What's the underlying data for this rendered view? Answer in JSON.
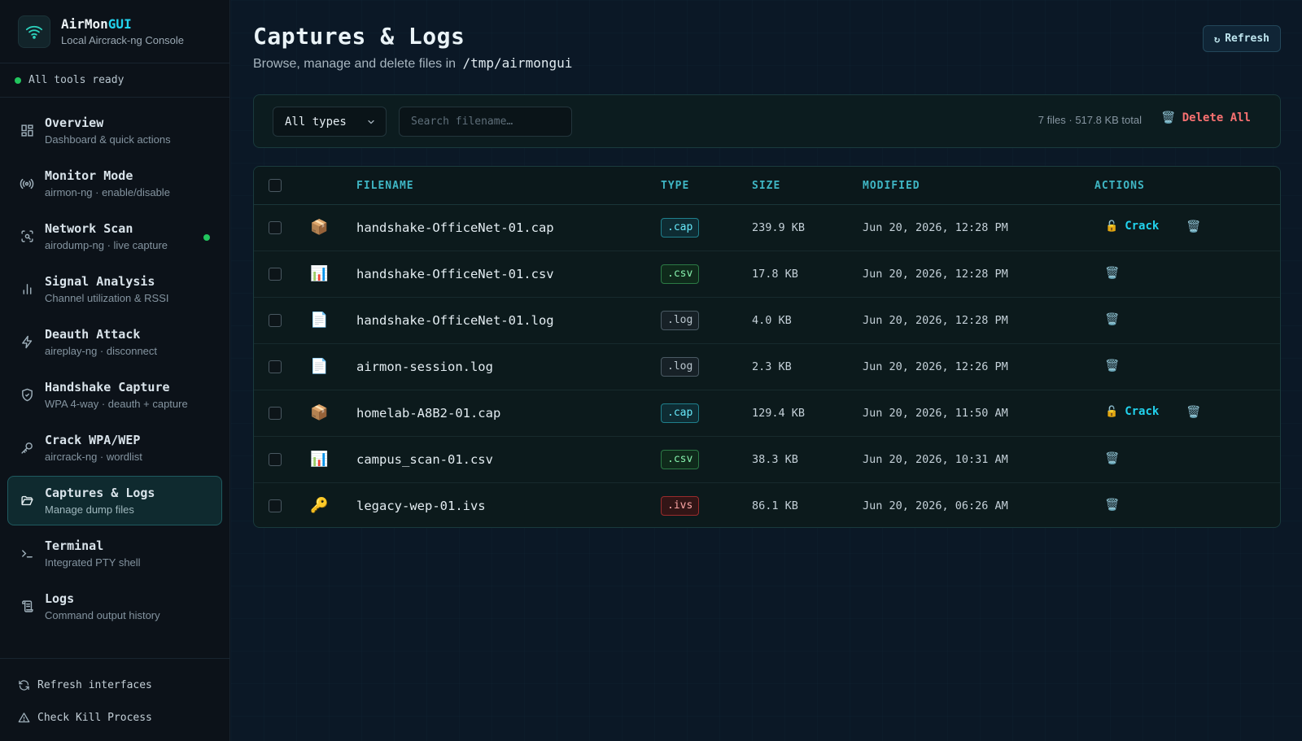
{
  "brand": {
    "name_main": "AirMon",
    "name_accent": "GUI",
    "subtitle": "Local Aircrack-ng Console"
  },
  "status": {
    "text": "All tools ready",
    "color": "#22c55e"
  },
  "nav": [
    {
      "label": "Overview",
      "desc": "Dashboard & quick actions",
      "icon": "grid-icon"
    },
    {
      "label": "Monitor Mode",
      "desc": "airmon-ng · enable/disable",
      "icon": "broadcast-icon"
    },
    {
      "label": "Network Scan",
      "desc": "airodump-ng · live capture",
      "icon": "scan-icon",
      "live": true
    },
    {
      "label": "Signal Analysis",
      "desc": "Channel utilization & RSSI",
      "icon": "bar-chart-icon"
    },
    {
      "label": "Deauth Attack",
      "desc": "aireplay-ng · disconnect",
      "icon": "lightning-icon"
    },
    {
      "label": "Handshake Capture",
      "desc": "WPA 4-way · deauth + capture",
      "icon": "shield-check-icon"
    },
    {
      "label": "Crack WPA/WEP",
      "desc": "aircrack-ng · wordlist",
      "icon": "key-icon"
    },
    {
      "label": "Captures & Logs",
      "desc": "Manage dump files",
      "icon": "folder-open-icon",
      "active": true
    },
    {
      "label": "Terminal",
      "desc": "Integrated PTY shell",
      "icon": "terminal-icon"
    },
    {
      "label": "Logs",
      "desc": "Command output history",
      "icon": "scroll-icon"
    }
  ],
  "footer": {
    "refresh_label": "Refresh interfaces",
    "kill_label": "Check Kill Process"
  },
  "page": {
    "title": "Captures & Logs",
    "subtitle_prefix": "Browse, manage and delete files in",
    "path": "/tmp/airmongui",
    "refresh_label": "Refresh",
    "refresh_glyph": "↻"
  },
  "toolbar": {
    "filter_value": "All types",
    "search_placeholder": "Search filename…",
    "file_count": "7 files",
    "total_size": "· 517.8 KB total",
    "delete_all_label": "Delete All"
  },
  "table": {
    "columns": {
      "filename": "FILENAME",
      "type": "TYPE",
      "size": "SIZE",
      "modified": "MODIFIED",
      "actions": "ACTIONS"
    },
    "crack_label": "Crack",
    "rows": [
      {
        "icon": "📦",
        "name": "handshake-OfficeNet-01.cap",
        "type": ".cap",
        "size": "239.9 KB",
        "modified": "Jun 20, 2026, 12:28 PM",
        "crack": true
      },
      {
        "icon": "📊",
        "name": "handshake-OfficeNet-01.csv",
        "type": ".csv",
        "size": "17.8 KB",
        "modified": "Jun 20, 2026, 12:28 PM",
        "crack": false
      },
      {
        "icon": "📄",
        "name": "handshake-OfficeNet-01.log",
        "type": ".log",
        "size": "4.0 KB",
        "modified": "Jun 20, 2026, 12:28 PM",
        "crack": false
      },
      {
        "icon": "📄",
        "name": "airmon-session.log",
        "type": ".log",
        "size": "2.3 KB",
        "modified": "Jun 20, 2026, 12:26 PM",
        "crack": false
      },
      {
        "icon": "📦",
        "name": "homelab-A8B2-01.cap",
        "type": ".cap",
        "size": "129.4 KB",
        "modified": "Jun 20, 2026, 11:50 AM",
        "crack": true
      },
      {
        "icon": "📊",
        "name": "campus_scan-01.csv",
        "type": ".csv",
        "size": "38.3 KB",
        "modified": "Jun 20, 2026, 10:31 AM",
        "crack": false
      },
      {
        "icon": "🔑",
        "name": "legacy-wep-01.ivs",
        "type": ".ivs",
        "size": "86.1 KB",
        "modified": "Jun 20, 2026, 06:26 AM",
        "crack": false
      }
    ]
  },
  "colors": {
    "accent": "#22d3ee",
    "danger": "#f87171",
    "ready": "#22c55e"
  }
}
